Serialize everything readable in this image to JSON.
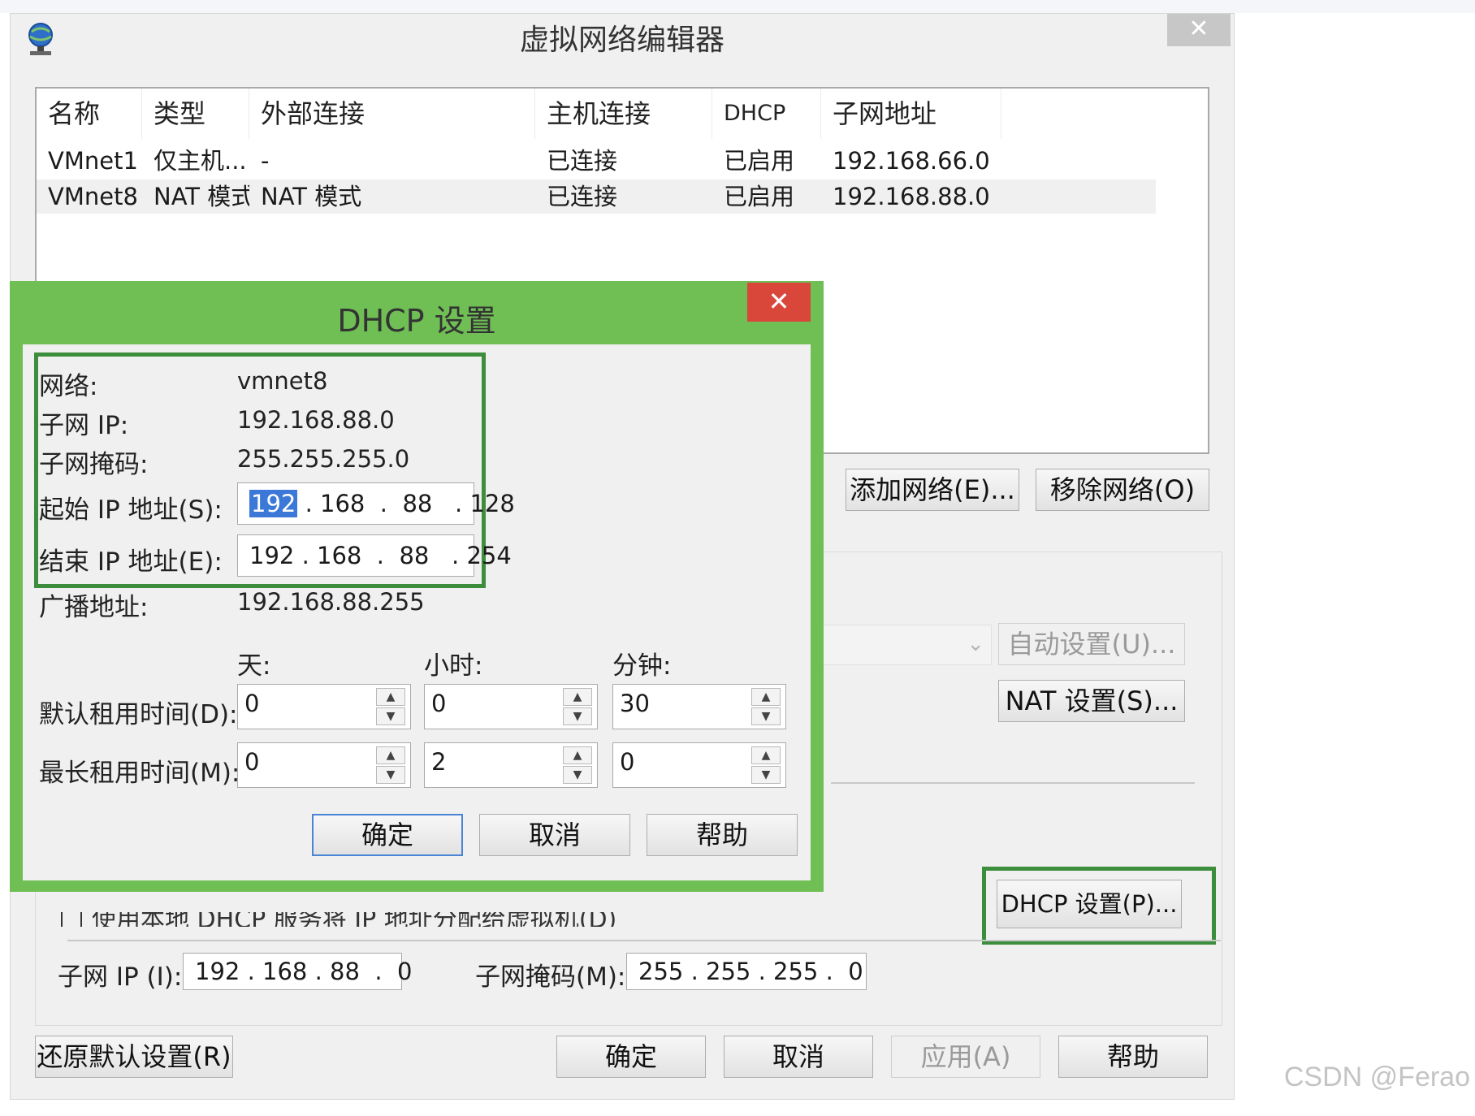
{
  "main_window": {
    "title": "虚拟网络编辑器",
    "close_symbol": "✕",
    "columns": [
      "名称",
      "类型",
      "外部连接",
      "主机连接",
      "DHCP",
      "子网地址"
    ],
    "rows": [
      {
        "name": "VMnet1",
        "type": "仅主机...",
        "external": "-",
        "host": "已连接",
        "dhcp": "已启用",
        "subnet": "192.168.66.0"
      },
      {
        "name": "VMnet8",
        "type": "NAT 模式",
        "external": "NAT 模式",
        "host": "已连接",
        "dhcp": "已启用",
        "subnet": "192.168.88.0"
      }
    ],
    "add_network_label": "添加网络(E)...",
    "remove_network_label": "移除网络(O)",
    "auto_settings_label": "自动设置(U)...",
    "nat_settings_label": "NAT 设置(S)...",
    "dhcp_settings_label": "DHCP 设置(P)...",
    "use_local_dhcp_label": "使用本地 DHCP 服务将 IP 地址分配给虚拟机(D)",
    "subnet_ip_label": "子网 IP (I):",
    "subnet_ip_value": "192 . 168 . 88  .  0",
    "subnet_mask_label": "子网掩码(M):",
    "subnet_mask_value": "255 . 255 . 255 .  0",
    "restore_defaults_label": "还原默认设置(R)",
    "ok_label": "确定",
    "cancel_label": "取消",
    "apply_label": "应用(A)",
    "help_label": "帮助"
  },
  "dhcp_dialog": {
    "title": "DHCP 设置",
    "close_symbol": "✕",
    "network_label": "网络:",
    "network_value": "vmnet8",
    "subnet_ip_label": "子网 IP:",
    "subnet_ip_value": "192.168.88.0",
    "subnet_mask_label": "子网掩码:",
    "subnet_mask_value": "255.255.255.0",
    "start_ip_label": "起始 IP 地址(S):",
    "start_ip_first": "192",
    "start_ip_rest": " . 168  .  88   . 128",
    "end_ip_label": "结束 IP 地址(E):",
    "end_ip_value": "192 . 168  .  88   . 254",
    "broadcast_label": "广播地址:",
    "broadcast_value": "192.168.88.255",
    "days_label": "天:",
    "hours_label": "小时:",
    "minutes_label": "分钟:",
    "default_lease_label": "默认租用时间(D):",
    "default_lease": {
      "days": "0",
      "hours": "0",
      "minutes": "30"
    },
    "max_lease_label": "最长租用时间(M):",
    "max_lease": {
      "days": "0",
      "hours": "2",
      "minutes": "0"
    },
    "ok_label": "确定",
    "cancel_label": "取消",
    "help_label": "帮助"
  },
  "watermark": "CSDN @Ferao",
  "colors": {
    "highlight_green": "#3c8d3c",
    "dialog_frame": "#6fbf55",
    "close_red": "#d9463a",
    "selection_blue": "#3b78d8"
  }
}
